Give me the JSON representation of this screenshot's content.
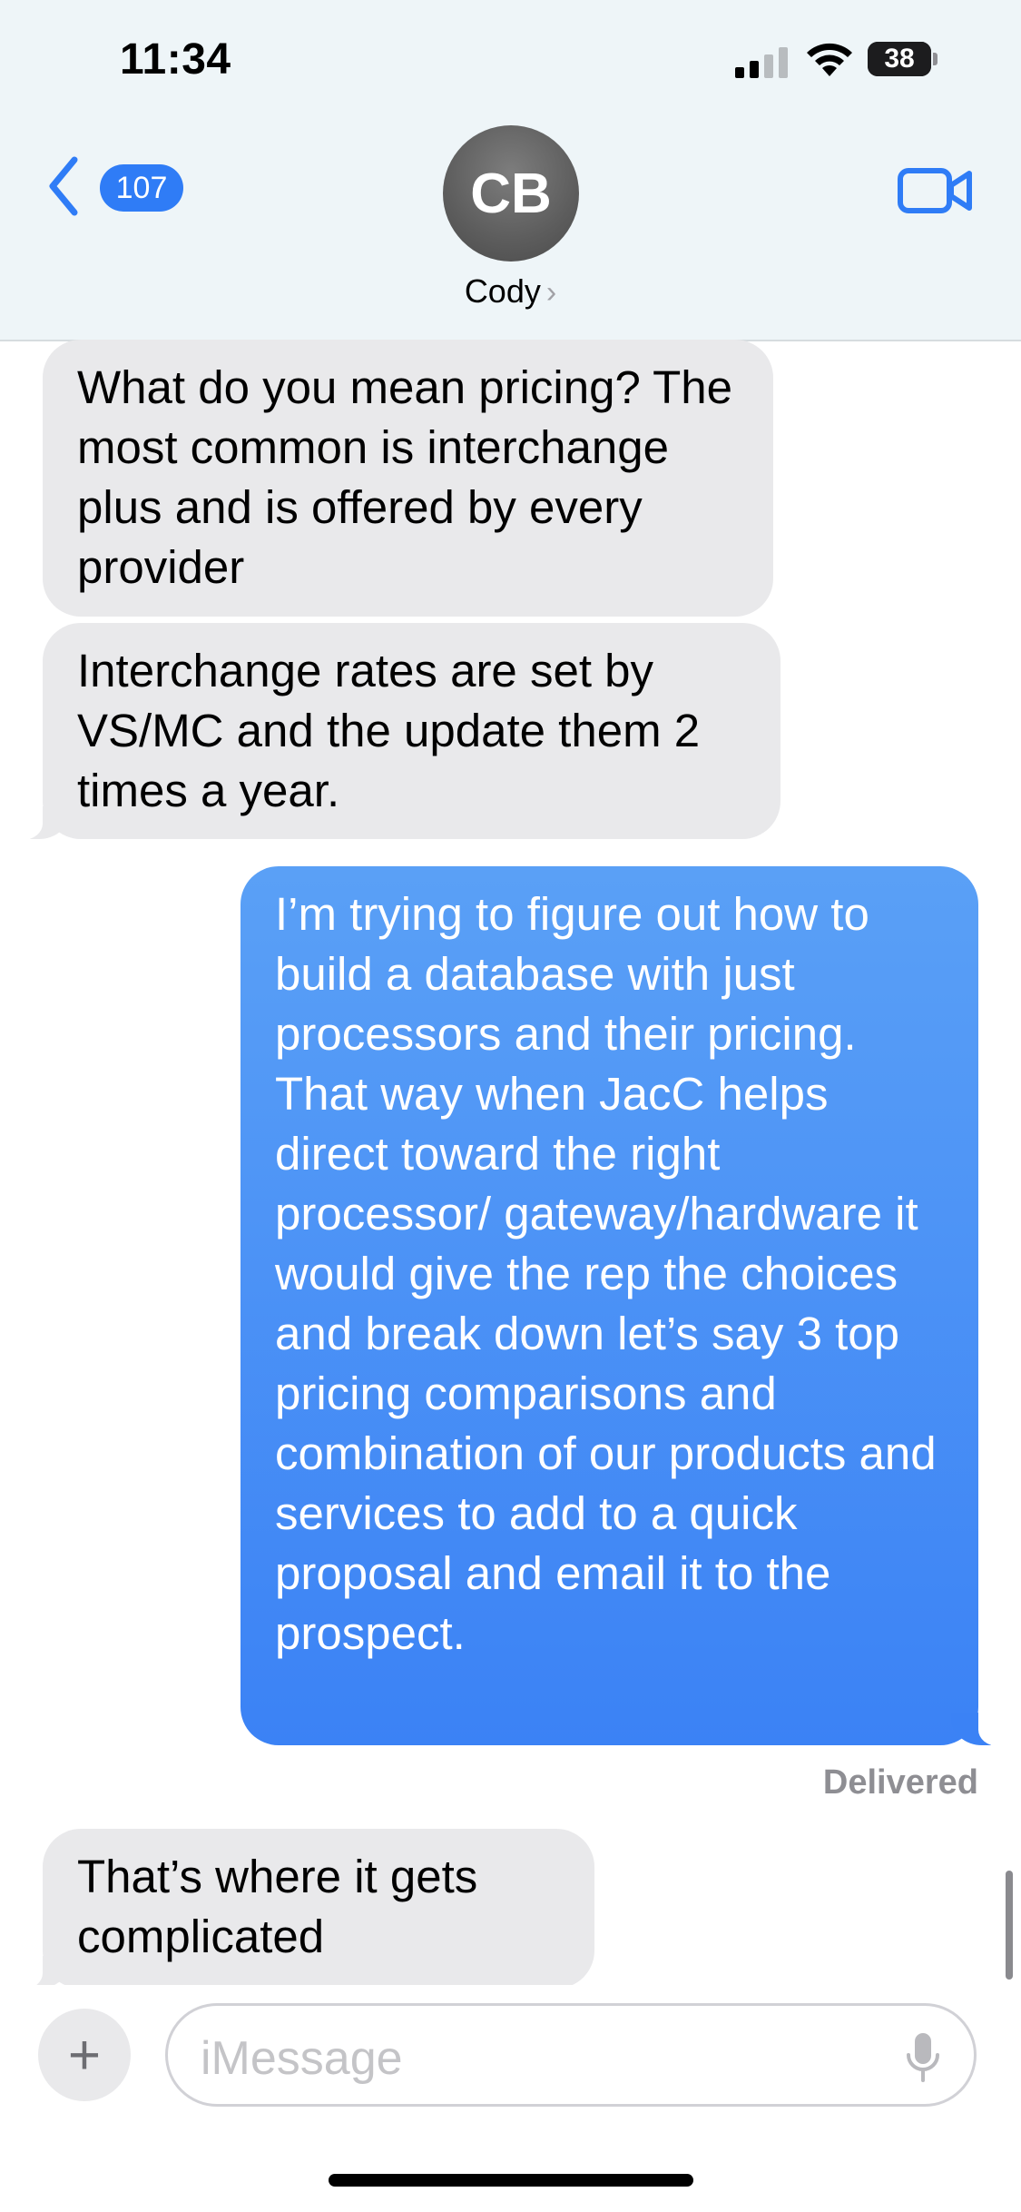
{
  "status_bar": {
    "time": "11:34",
    "battery_level": "38"
  },
  "header": {
    "back_count": "107",
    "avatar_initials": "CB",
    "contact_name": "Cody",
    "contact_chevron": "›"
  },
  "messages": [
    {
      "direction": "received",
      "text": "What do you mean pricing? The most common is interchange plus and is offered by every provider"
    },
    {
      "direction": "received",
      "text": "Interchange rates are set by VS/MC and the update them 2 times a year."
    },
    {
      "direction": "sent",
      "text": "I’m trying to figure out how to build a database with just processors and their pricing. That way when JacC helps direct toward the right processor/ gateway/hardware it would give the rep the choices and break down let’s say 3 top pricing comparisons and combination of our products and services to add to a quick proposal and email it to the prospect."
    },
    {
      "direction": "received",
      "text": "That’s where it gets complicated"
    }
  ],
  "delivery_status": "Delivered",
  "composer": {
    "plus_label": "+",
    "placeholder": "iMessage"
  },
  "colors": {
    "sent_bubble": "#3b82f5",
    "received_bubble": "#e9e9eb",
    "accent": "#2f7cf6"
  }
}
